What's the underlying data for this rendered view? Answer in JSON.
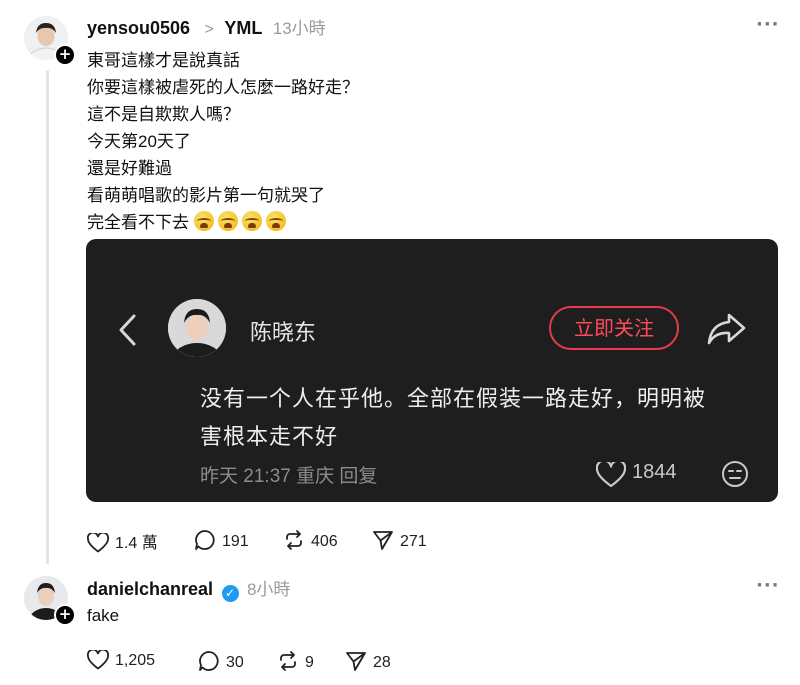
{
  "post": {
    "username": "yensou0506",
    "reply_target": "YML",
    "time": "13小時",
    "more": "···",
    "lines": [
      "東哥這樣才是說真話",
      "你要這樣被虐死的人怎麼一路好走？",
      "這不是自欺欺人嗎？",
      "今天第20天了",
      "還是好難過",
      "看萌萌唱歌的影片第一句就哭了",
      "完全看不下去"
    ],
    "emoji": "loudly-crying-face",
    "emoji_count": 4,
    "actions": {
      "likes": "1.4 萬",
      "replies": "191",
      "reposts": "406",
      "shares": "271"
    }
  },
  "embed": {
    "name": "陈晓东",
    "follow_label": "立即关注",
    "text_line1": "没有一个人在乎他。全部在假装一路走好，明明被",
    "text_line2": "害根本走不好",
    "meta": "昨天 21:37 重庆 回复",
    "likes": "1844",
    "colors": {
      "background": "#1e1e1e",
      "accent": "#e8394a"
    }
  },
  "reply": {
    "username": "danielchanreal",
    "verified": true,
    "time": "8小時",
    "more": "···",
    "text": "fake",
    "actions": {
      "likes": "1,205",
      "replies": "30",
      "reposts": "9",
      "shares": "28"
    }
  }
}
